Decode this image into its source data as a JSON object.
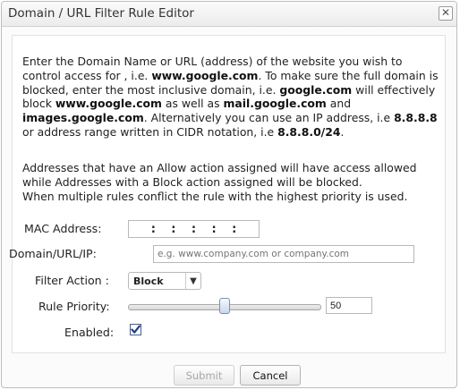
{
  "dialog": {
    "title": "Domain / URL Filter Rule Editor",
    "close_glyph": "✕"
  },
  "intro": {
    "t1": "Enter the Domain Name or URL (address) of the website you wish to control access for , i.e. ",
    "b1": "www.google.com",
    "t2": ". To make sure the full domain is blocked, enter the most inclusive domain, i.e. ",
    "b2": "google.com",
    "t3": " will effectively block ",
    "b3": "www.google.com",
    "t4": " as well as ",
    "b4": "mail.google.com",
    "t5": " and ",
    "b5": "images.google.com",
    "t6": ". Alternatively you can use an IP address, i.e ",
    "b6": "8.8.8.8",
    "t7": " or address range written in CIDR notation, i.e ",
    "b7": "8.8.8.0/24",
    "t8": "."
  },
  "note": {
    "line1": "Addresses that have an Allow action assigned will have access allowed while Addresses with a Block action assigned will be blocked.",
    "line2": "When multiple rules conflict the rule with the highest priority is used."
  },
  "form": {
    "mac_label": "MAC Address:",
    "mac_separators": [
      ":",
      ":",
      ":",
      ":",
      ":"
    ],
    "domain_label": "Domain/URL/IP:",
    "domain_placeholder": "e.g. www.company.com or company.com",
    "action_label": "Filter Action :",
    "action_value": "Block",
    "action_arrow": "▼",
    "priority_label": "Rule Priority:",
    "priority_value": "50",
    "priority_fraction": 0.5,
    "enabled_label": "Enabled:",
    "enabled_checked": true
  },
  "buttons": {
    "submit": "Submit",
    "cancel": "Cancel"
  }
}
